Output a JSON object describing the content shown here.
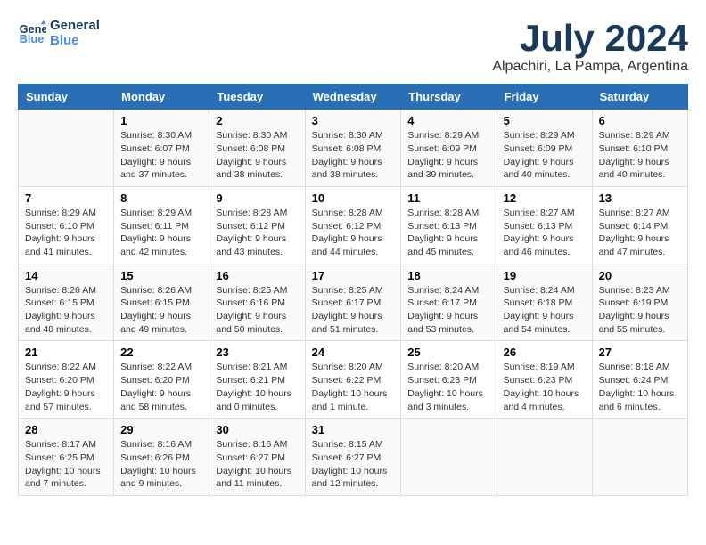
{
  "logo": {
    "line1": "General",
    "line2": "Blue"
  },
  "title": "July 2024",
  "location": "Alpachiri, La Pampa, Argentina",
  "weekdays": [
    "Sunday",
    "Monday",
    "Tuesday",
    "Wednesday",
    "Thursday",
    "Friday",
    "Saturday"
  ],
  "weeks": [
    [
      {
        "day": "",
        "info": ""
      },
      {
        "day": "1",
        "info": "Sunrise: 8:30 AM\nSunset: 6:07 PM\nDaylight: 9 hours\nand 37 minutes."
      },
      {
        "day": "2",
        "info": "Sunrise: 8:30 AM\nSunset: 6:08 PM\nDaylight: 9 hours\nand 38 minutes."
      },
      {
        "day": "3",
        "info": "Sunrise: 8:30 AM\nSunset: 6:08 PM\nDaylight: 9 hours\nand 38 minutes."
      },
      {
        "day": "4",
        "info": "Sunrise: 8:29 AM\nSunset: 6:09 PM\nDaylight: 9 hours\nand 39 minutes."
      },
      {
        "day": "5",
        "info": "Sunrise: 8:29 AM\nSunset: 6:09 PM\nDaylight: 9 hours\nand 40 minutes."
      },
      {
        "day": "6",
        "info": "Sunrise: 8:29 AM\nSunset: 6:10 PM\nDaylight: 9 hours\nand 40 minutes."
      }
    ],
    [
      {
        "day": "7",
        "info": "Sunrise: 8:29 AM\nSunset: 6:10 PM\nDaylight: 9 hours\nand 41 minutes."
      },
      {
        "day": "8",
        "info": "Sunrise: 8:29 AM\nSunset: 6:11 PM\nDaylight: 9 hours\nand 42 minutes."
      },
      {
        "day": "9",
        "info": "Sunrise: 8:28 AM\nSunset: 6:12 PM\nDaylight: 9 hours\nand 43 minutes."
      },
      {
        "day": "10",
        "info": "Sunrise: 8:28 AM\nSunset: 6:12 PM\nDaylight: 9 hours\nand 44 minutes."
      },
      {
        "day": "11",
        "info": "Sunrise: 8:28 AM\nSunset: 6:13 PM\nDaylight: 9 hours\nand 45 minutes."
      },
      {
        "day": "12",
        "info": "Sunrise: 8:27 AM\nSunset: 6:13 PM\nDaylight: 9 hours\nand 46 minutes."
      },
      {
        "day": "13",
        "info": "Sunrise: 8:27 AM\nSunset: 6:14 PM\nDaylight: 9 hours\nand 47 minutes."
      }
    ],
    [
      {
        "day": "14",
        "info": "Sunrise: 8:26 AM\nSunset: 6:15 PM\nDaylight: 9 hours\nand 48 minutes."
      },
      {
        "day": "15",
        "info": "Sunrise: 8:26 AM\nSunset: 6:15 PM\nDaylight: 9 hours\nand 49 minutes."
      },
      {
        "day": "16",
        "info": "Sunrise: 8:25 AM\nSunset: 6:16 PM\nDaylight: 9 hours\nand 50 minutes."
      },
      {
        "day": "17",
        "info": "Sunrise: 8:25 AM\nSunset: 6:17 PM\nDaylight: 9 hours\nand 51 minutes."
      },
      {
        "day": "18",
        "info": "Sunrise: 8:24 AM\nSunset: 6:17 PM\nDaylight: 9 hours\nand 53 minutes."
      },
      {
        "day": "19",
        "info": "Sunrise: 8:24 AM\nSunset: 6:18 PM\nDaylight: 9 hours\nand 54 minutes."
      },
      {
        "day": "20",
        "info": "Sunrise: 8:23 AM\nSunset: 6:19 PM\nDaylight: 9 hours\nand 55 minutes."
      }
    ],
    [
      {
        "day": "21",
        "info": "Sunrise: 8:22 AM\nSunset: 6:20 PM\nDaylight: 9 hours\nand 57 minutes."
      },
      {
        "day": "22",
        "info": "Sunrise: 8:22 AM\nSunset: 6:20 PM\nDaylight: 9 hours\nand 58 minutes."
      },
      {
        "day": "23",
        "info": "Sunrise: 8:21 AM\nSunset: 6:21 PM\nDaylight: 10 hours\nand 0 minutes."
      },
      {
        "day": "24",
        "info": "Sunrise: 8:20 AM\nSunset: 6:22 PM\nDaylight: 10 hours\nand 1 minute."
      },
      {
        "day": "25",
        "info": "Sunrise: 8:20 AM\nSunset: 6:23 PM\nDaylight: 10 hours\nand 3 minutes."
      },
      {
        "day": "26",
        "info": "Sunrise: 8:19 AM\nSunset: 6:23 PM\nDaylight: 10 hours\nand 4 minutes."
      },
      {
        "day": "27",
        "info": "Sunrise: 8:18 AM\nSunset: 6:24 PM\nDaylight: 10 hours\nand 6 minutes."
      }
    ],
    [
      {
        "day": "28",
        "info": "Sunrise: 8:17 AM\nSunset: 6:25 PM\nDaylight: 10 hours\nand 7 minutes."
      },
      {
        "day": "29",
        "info": "Sunrise: 8:16 AM\nSunset: 6:26 PM\nDaylight: 10 hours\nand 9 minutes."
      },
      {
        "day": "30",
        "info": "Sunrise: 8:16 AM\nSunset: 6:27 PM\nDaylight: 10 hours\nand 11 minutes."
      },
      {
        "day": "31",
        "info": "Sunrise: 8:15 AM\nSunset: 6:27 PM\nDaylight: 10 hours\nand 12 minutes."
      },
      {
        "day": "",
        "info": ""
      },
      {
        "day": "",
        "info": ""
      },
      {
        "day": "",
        "info": ""
      }
    ]
  ]
}
